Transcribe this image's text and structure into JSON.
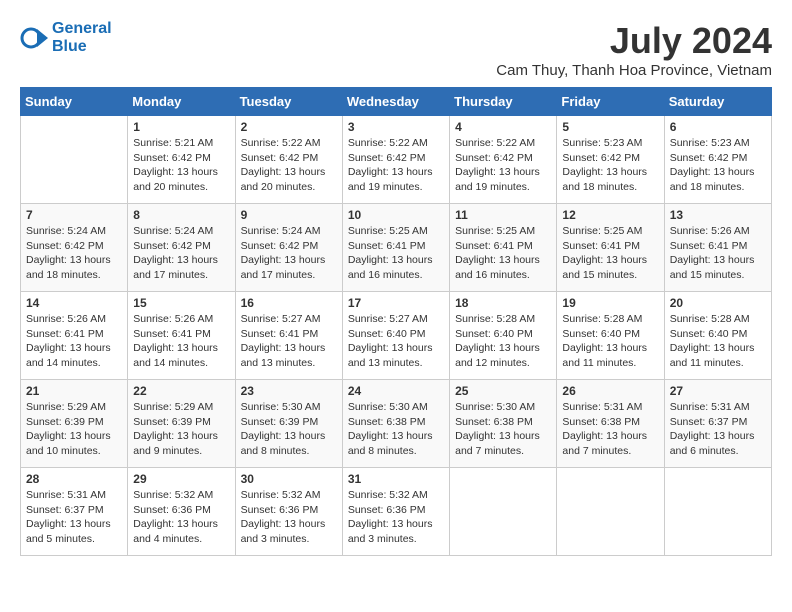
{
  "header": {
    "logo_line1": "General",
    "logo_line2": "Blue",
    "month_title": "July 2024",
    "subtitle": "Cam Thuy, Thanh Hoa Province, Vietnam"
  },
  "days_of_week": [
    "Sunday",
    "Monday",
    "Tuesday",
    "Wednesday",
    "Thursday",
    "Friday",
    "Saturday"
  ],
  "weeks": [
    [
      {
        "day": "",
        "info": ""
      },
      {
        "day": "1",
        "info": "Sunrise: 5:21 AM\nSunset: 6:42 PM\nDaylight: 13 hours\nand 20 minutes."
      },
      {
        "day": "2",
        "info": "Sunrise: 5:22 AM\nSunset: 6:42 PM\nDaylight: 13 hours\nand 20 minutes."
      },
      {
        "day": "3",
        "info": "Sunrise: 5:22 AM\nSunset: 6:42 PM\nDaylight: 13 hours\nand 19 minutes."
      },
      {
        "day": "4",
        "info": "Sunrise: 5:22 AM\nSunset: 6:42 PM\nDaylight: 13 hours\nand 19 minutes."
      },
      {
        "day": "5",
        "info": "Sunrise: 5:23 AM\nSunset: 6:42 PM\nDaylight: 13 hours\nand 18 minutes."
      },
      {
        "day": "6",
        "info": "Sunrise: 5:23 AM\nSunset: 6:42 PM\nDaylight: 13 hours\nand 18 minutes."
      }
    ],
    [
      {
        "day": "7",
        "info": "Sunrise: 5:24 AM\nSunset: 6:42 PM\nDaylight: 13 hours\nand 18 minutes."
      },
      {
        "day": "8",
        "info": "Sunrise: 5:24 AM\nSunset: 6:42 PM\nDaylight: 13 hours\nand 17 minutes."
      },
      {
        "day": "9",
        "info": "Sunrise: 5:24 AM\nSunset: 6:42 PM\nDaylight: 13 hours\nand 17 minutes."
      },
      {
        "day": "10",
        "info": "Sunrise: 5:25 AM\nSunset: 6:41 PM\nDaylight: 13 hours\nand 16 minutes."
      },
      {
        "day": "11",
        "info": "Sunrise: 5:25 AM\nSunset: 6:41 PM\nDaylight: 13 hours\nand 16 minutes."
      },
      {
        "day": "12",
        "info": "Sunrise: 5:25 AM\nSunset: 6:41 PM\nDaylight: 13 hours\nand 15 minutes."
      },
      {
        "day": "13",
        "info": "Sunrise: 5:26 AM\nSunset: 6:41 PM\nDaylight: 13 hours\nand 15 minutes."
      }
    ],
    [
      {
        "day": "14",
        "info": "Sunrise: 5:26 AM\nSunset: 6:41 PM\nDaylight: 13 hours\nand 14 minutes."
      },
      {
        "day": "15",
        "info": "Sunrise: 5:26 AM\nSunset: 6:41 PM\nDaylight: 13 hours\nand 14 minutes."
      },
      {
        "day": "16",
        "info": "Sunrise: 5:27 AM\nSunset: 6:41 PM\nDaylight: 13 hours\nand 13 minutes."
      },
      {
        "day": "17",
        "info": "Sunrise: 5:27 AM\nSunset: 6:40 PM\nDaylight: 13 hours\nand 13 minutes."
      },
      {
        "day": "18",
        "info": "Sunrise: 5:28 AM\nSunset: 6:40 PM\nDaylight: 13 hours\nand 12 minutes."
      },
      {
        "day": "19",
        "info": "Sunrise: 5:28 AM\nSunset: 6:40 PM\nDaylight: 13 hours\nand 11 minutes."
      },
      {
        "day": "20",
        "info": "Sunrise: 5:28 AM\nSunset: 6:40 PM\nDaylight: 13 hours\nand 11 minutes."
      }
    ],
    [
      {
        "day": "21",
        "info": "Sunrise: 5:29 AM\nSunset: 6:39 PM\nDaylight: 13 hours\nand 10 minutes."
      },
      {
        "day": "22",
        "info": "Sunrise: 5:29 AM\nSunset: 6:39 PM\nDaylight: 13 hours\nand 9 minutes."
      },
      {
        "day": "23",
        "info": "Sunrise: 5:30 AM\nSunset: 6:39 PM\nDaylight: 13 hours\nand 8 minutes."
      },
      {
        "day": "24",
        "info": "Sunrise: 5:30 AM\nSunset: 6:38 PM\nDaylight: 13 hours\nand 8 minutes."
      },
      {
        "day": "25",
        "info": "Sunrise: 5:30 AM\nSunset: 6:38 PM\nDaylight: 13 hours\nand 7 minutes."
      },
      {
        "day": "26",
        "info": "Sunrise: 5:31 AM\nSunset: 6:38 PM\nDaylight: 13 hours\nand 7 minutes."
      },
      {
        "day": "27",
        "info": "Sunrise: 5:31 AM\nSunset: 6:37 PM\nDaylight: 13 hours\nand 6 minutes."
      }
    ],
    [
      {
        "day": "28",
        "info": "Sunrise: 5:31 AM\nSunset: 6:37 PM\nDaylight: 13 hours\nand 5 minutes."
      },
      {
        "day": "29",
        "info": "Sunrise: 5:32 AM\nSunset: 6:36 PM\nDaylight: 13 hours\nand 4 minutes."
      },
      {
        "day": "30",
        "info": "Sunrise: 5:32 AM\nSunset: 6:36 PM\nDaylight: 13 hours\nand 3 minutes."
      },
      {
        "day": "31",
        "info": "Sunrise: 5:32 AM\nSunset: 6:36 PM\nDaylight: 13 hours\nand 3 minutes."
      },
      {
        "day": "",
        "info": ""
      },
      {
        "day": "",
        "info": ""
      },
      {
        "day": "",
        "info": ""
      }
    ]
  ]
}
